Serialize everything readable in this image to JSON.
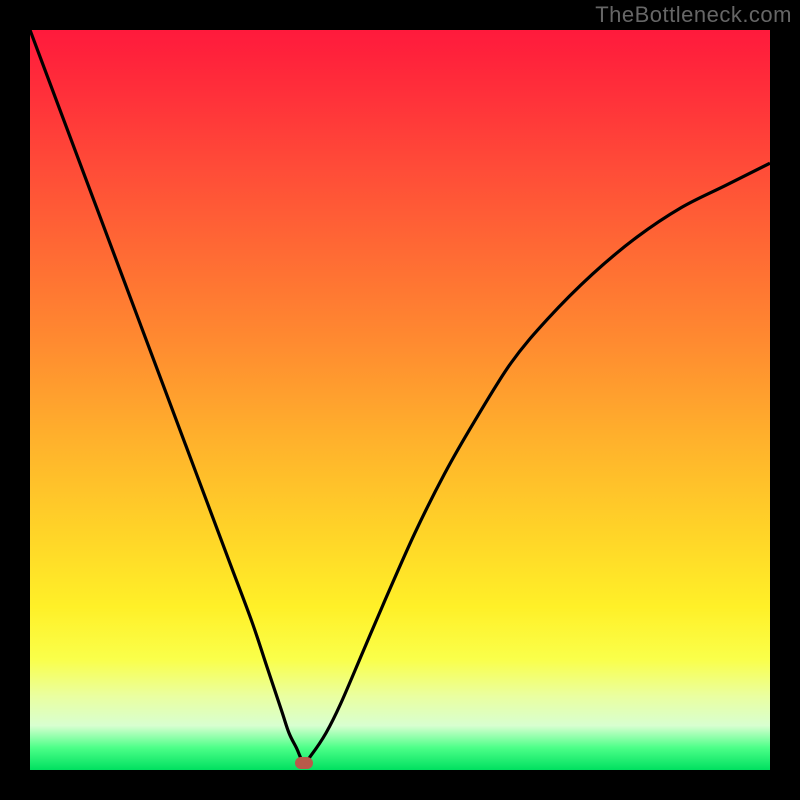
{
  "watermark": "TheBottleneck.com",
  "colors": {
    "frame": "#000000",
    "curve": "#000000",
    "marker": "#b85a4a",
    "gradient_top": "#ff1a3c",
    "gradient_bottom": "#00e060"
  },
  "chart_data": {
    "type": "line",
    "title": "",
    "xlabel": "",
    "ylabel": "",
    "xlim": [
      0,
      100
    ],
    "ylim": [
      0,
      100
    ],
    "annotations": [
      {
        "type": "marker",
        "x": 37,
        "y": 1,
        "shape": "rounded-rect",
        "color": "#b85a4a"
      }
    ],
    "series": [
      {
        "name": "bottleneck-curve",
        "x": [
          0,
          3,
          6,
          9,
          12,
          15,
          18,
          21,
          24,
          27,
          30,
          32,
          34,
          35,
          36,
          37,
          38,
          40,
          42,
          45,
          48,
          52,
          56,
          60,
          65,
          70,
          76,
          82,
          88,
          94,
          100
        ],
        "y": [
          100,
          92,
          84,
          76,
          68,
          60,
          52,
          44,
          36,
          28,
          20,
          14,
          8,
          5,
          3,
          1,
          2,
          5,
          9,
          16,
          23,
          32,
          40,
          47,
          55,
          61,
          67,
          72,
          76,
          79,
          82
        ]
      }
    ]
  }
}
